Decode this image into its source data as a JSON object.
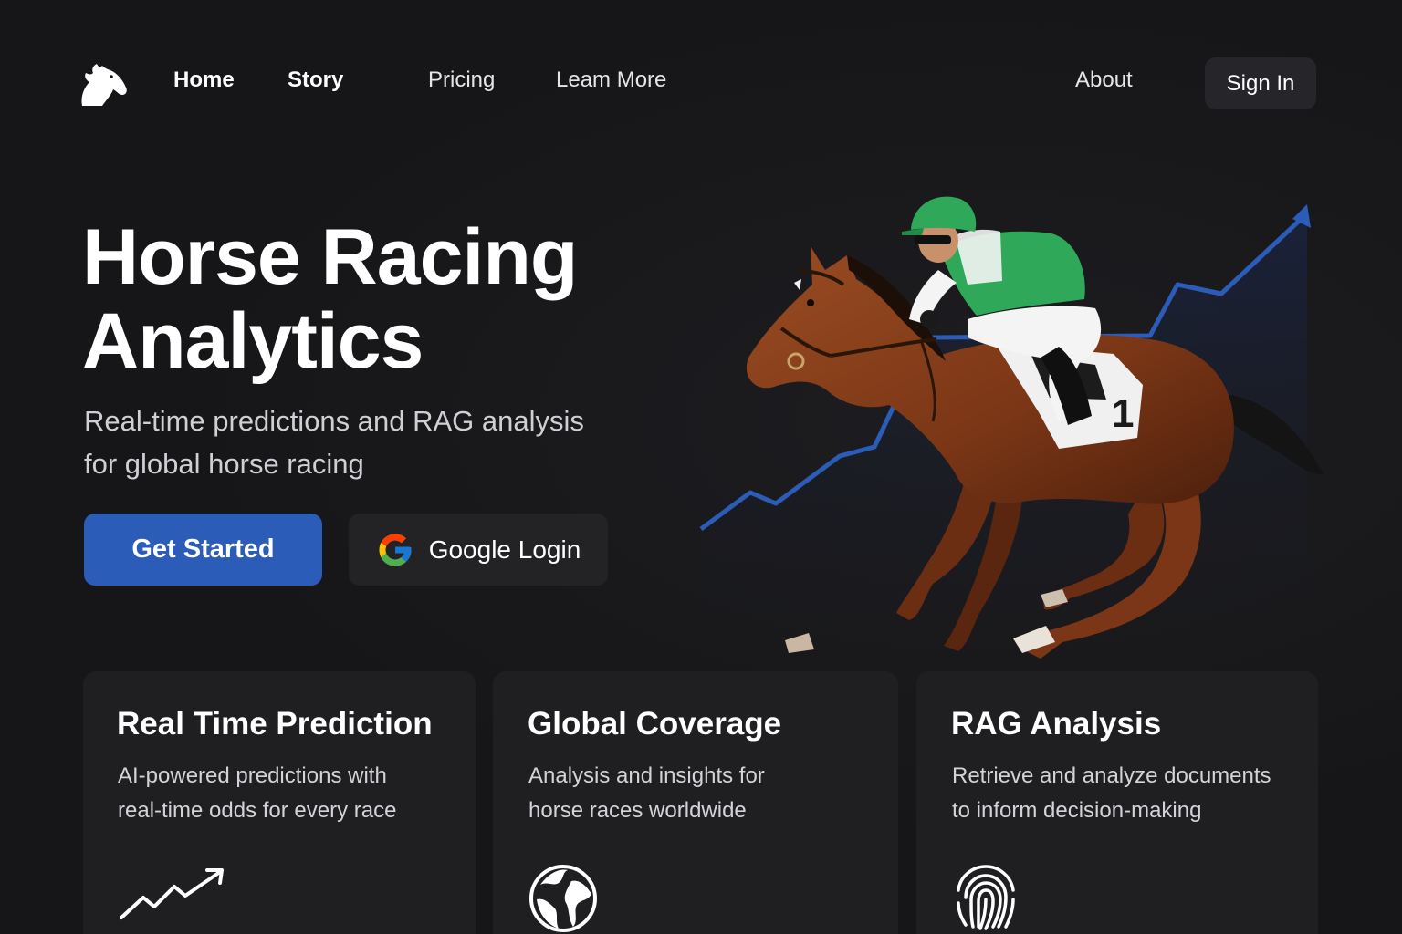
{
  "nav": {
    "logo_icon": "horse-head-icon",
    "links": [
      "Home",
      "Story",
      "Pricing",
      "Leam More",
      "About"
    ],
    "sign_in": "Sign In"
  },
  "hero": {
    "title_line1": "Horse Racing",
    "title_line2": "Analytics",
    "subtitle_line1": "Real-time predictions and RAG analysis",
    "subtitle_line2": "for global horse racing",
    "primary_button": "Get Started",
    "google_button": "Google Login",
    "google_icon": "google-g-icon",
    "saddle_number": "1",
    "illustration": "jockey-racehorse-with-rising-trend-line"
  },
  "features": [
    {
      "title": "Real Time Prediction",
      "desc_line1": "AI-powered predictions with",
      "desc_line2": "real-time odds for every race",
      "icon": "trend-up-icon"
    },
    {
      "title": "Global Coverage",
      "desc_line1": "Analysis and insights for",
      "desc_line2": "horse races worldwide",
      "icon": "globe-icon"
    },
    {
      "title": "RAG Analysis",
      "desc_line1": "Retrieve and analyze documents",
      "desc_line2": "to inform decision-making",
      "icon": "fingerprint-icon"
    }
  ],
  "colors": {
    "background": "#161618",
    "card": "#1f1f22",
    "accent_blue": "#2b5cb8",
    "jockey_green": "#2fa85a"
  }
}
